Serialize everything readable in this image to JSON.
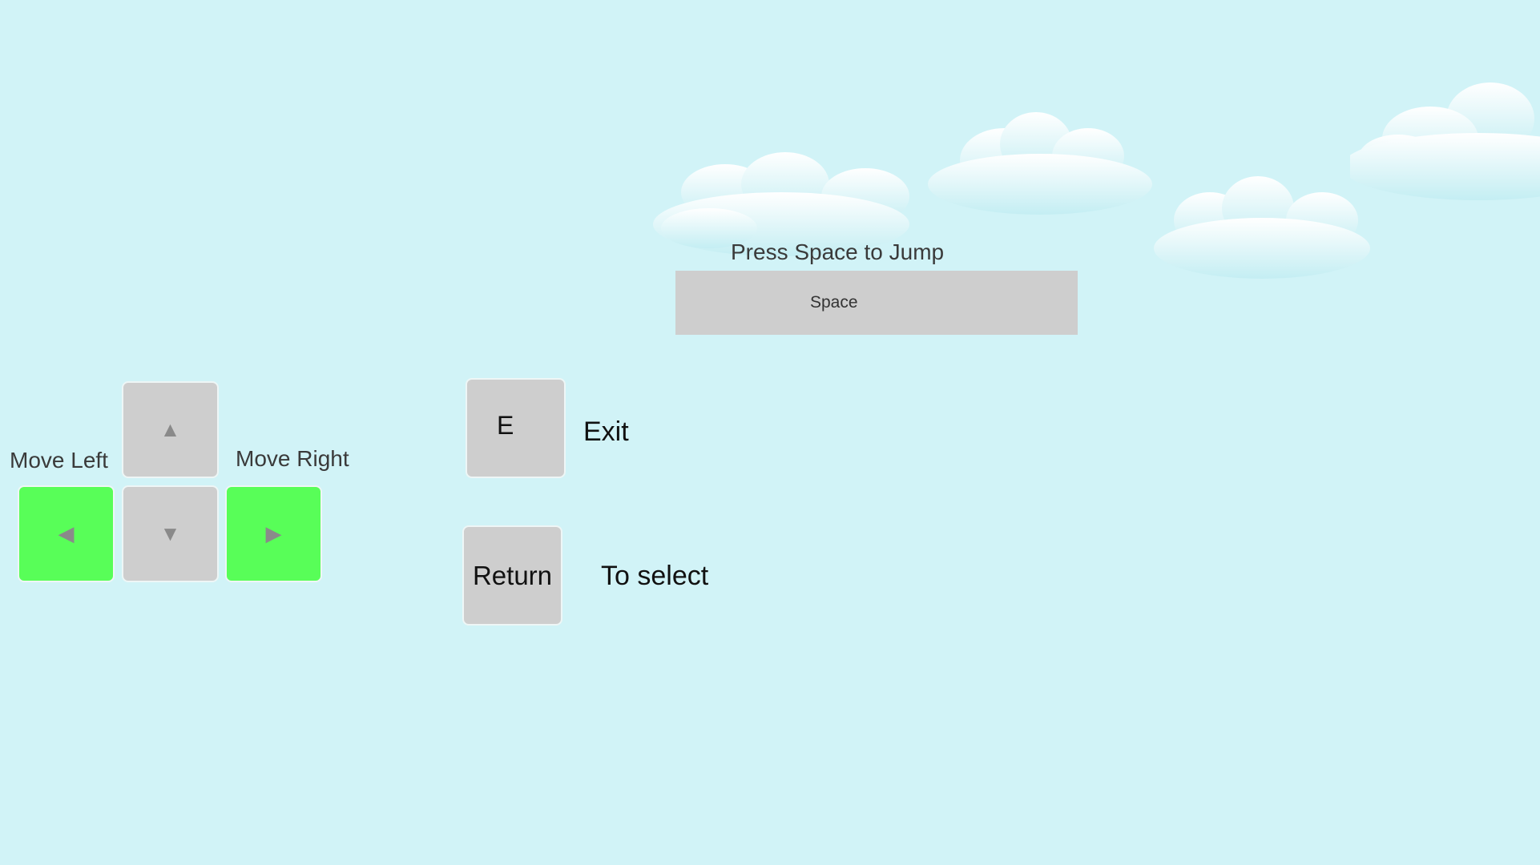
{
  "colors": {
    "background": "#d1f3f7",
    "key": "#cecece",
    "key_active": "#58fe58",
    "arrow": "#8a8a8a"
  },
  "jump": {
    "hint": "Press Space to Jump",
    "key_label": "Space"
  },
  "movement": {
    "left_label": "Move Left",
    "right_label": "Move Right",
    "keys": {
      "up": "▲",
      "down": "▼",
      "left": "◀",
      "right": "▶"
    },
    "active": [
      "left",
      "right"
    ]
  },
  "exit": {
    "key_label": "E",
    "action_label": "Exit"
  },
  "select": {
    "key_label": "Return",
    "action_label": "To select"
  }
}
